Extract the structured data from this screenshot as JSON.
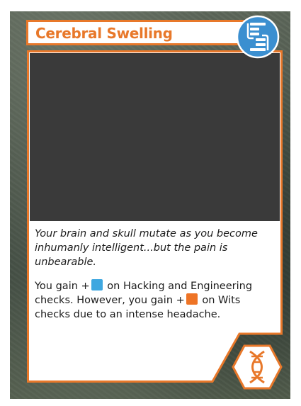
{
  "card": {
    "title": "Cerebral Swelling",
    "flavor_text": "Your brain and skull mutate as you become inhumanly intelligent...but the pain is unbearable.",
    "rules": {
      "part1": "You gain +",
      "part2": " on Hacking and Engineering checks. However, you gain +",
      "part3": " on Wits checks due to an intense headache."
    },
    "dice": {
      "positive": {
        "color": "#3ea7e0",
        "name": "blue-die"
      },
      "negative": {
        "color": "#ee7426",
        "name": "orange-die"
      }
    },
    "type_icon": "brain-type-icon",
    "footer_icon": "dna-icon",
    "accent_color": "#e8782a"
  }
}
